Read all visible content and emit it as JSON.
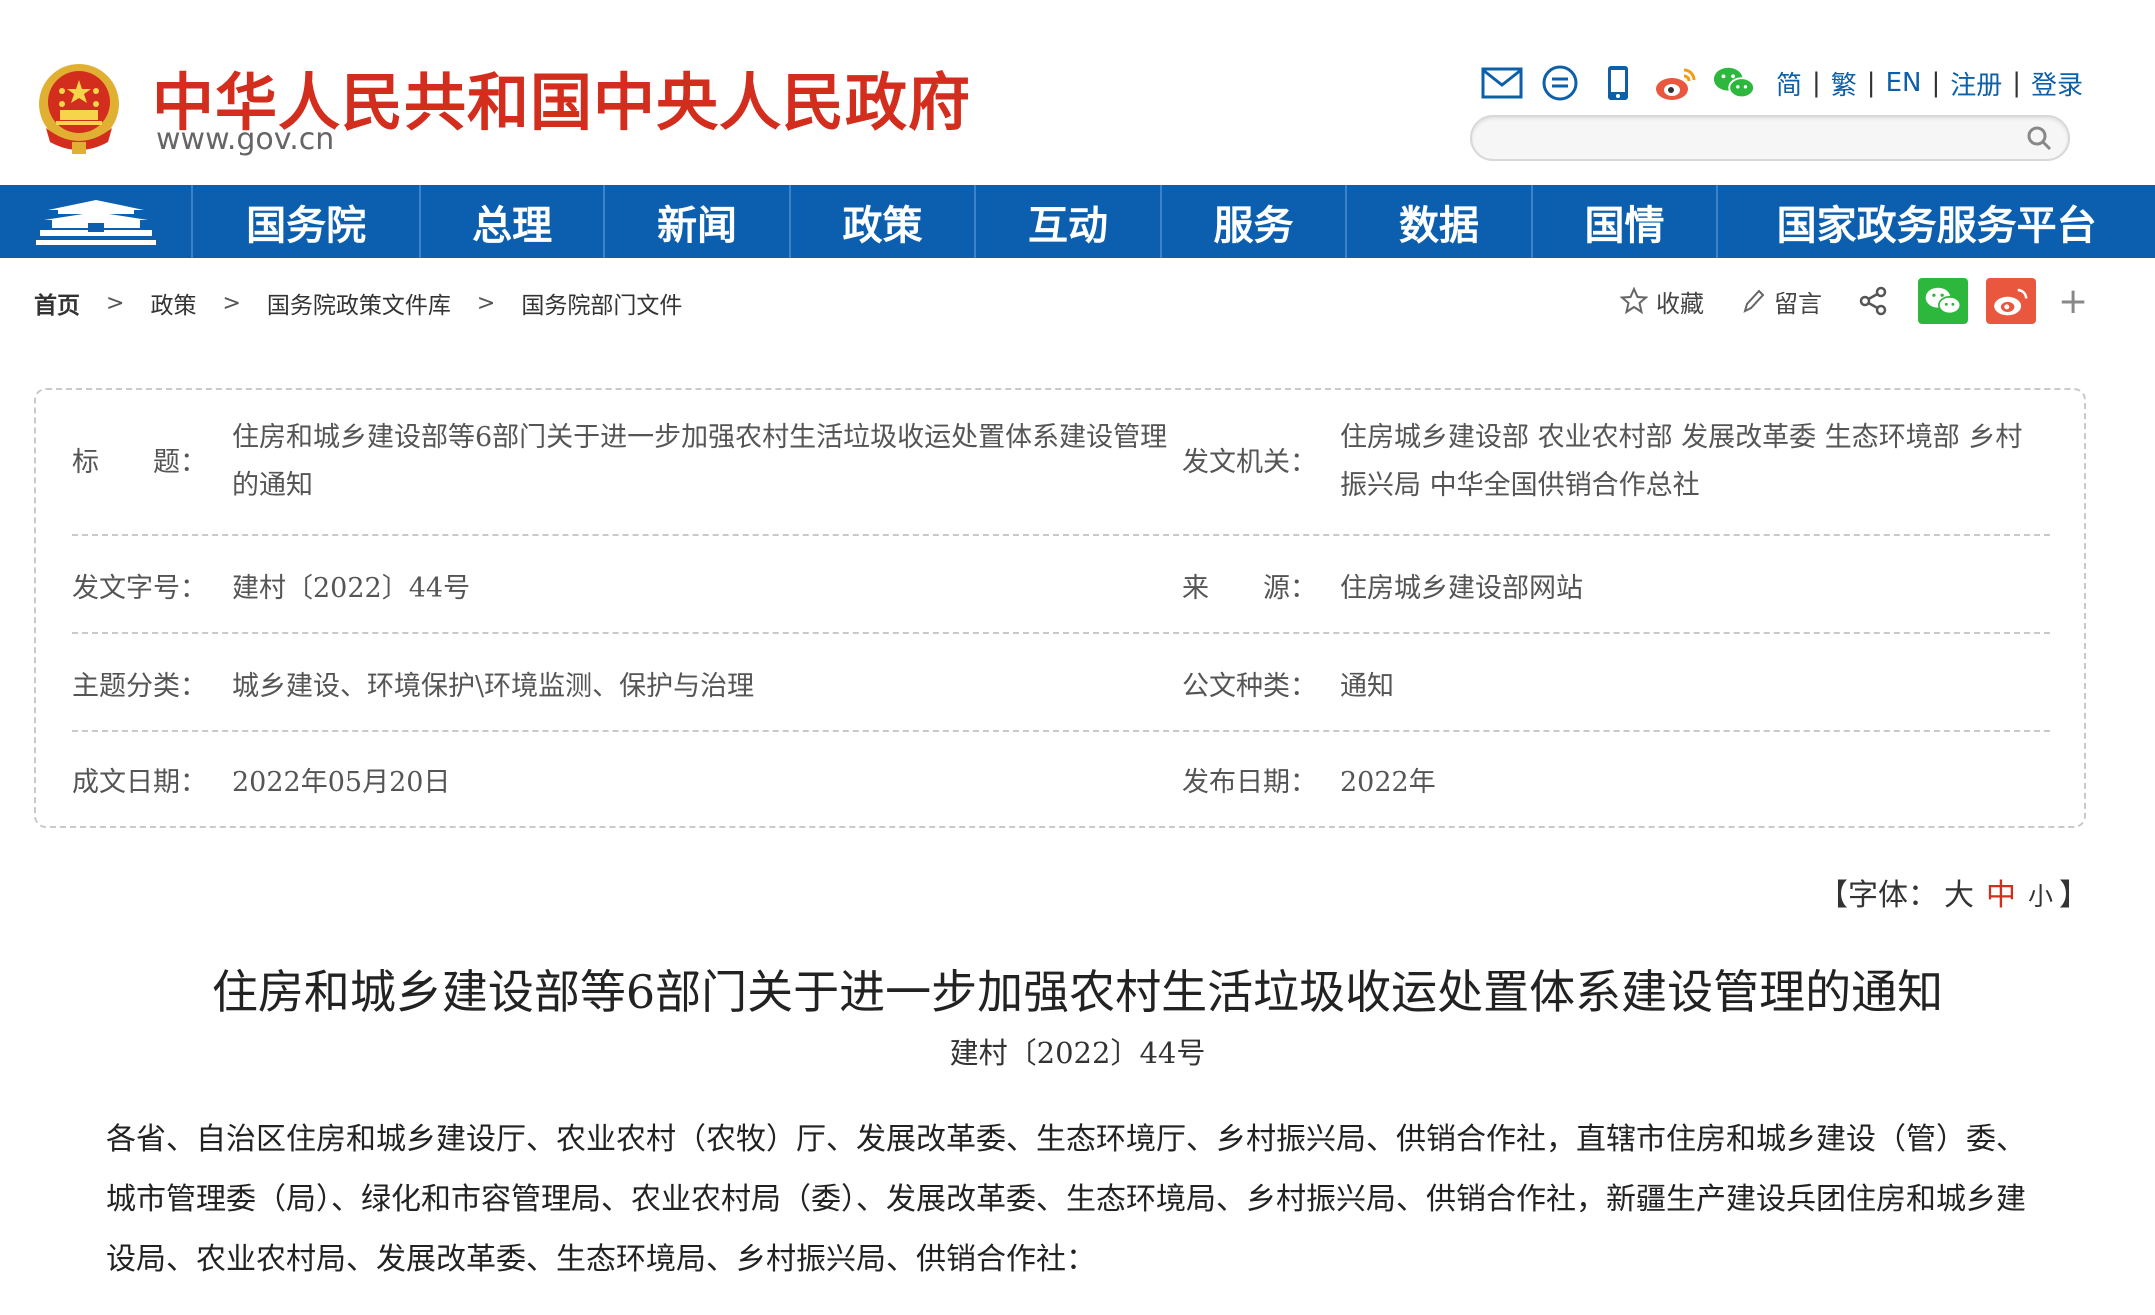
{
  "header": {
    "site_title": "中华人民共和国中央人民政府",
    "site_url": "www.gov.cn",
    "lang_links": [
      "简",
      "繁",
      "EN",
      "注册",
      "登录"
    ],
    "tool_icons": [
      "mail-icon",
      "message-icon",
      "mobile-icon",
      "weibo-icon",
      "wechat-icon"
    ],
    "search": {
      "placeholder": ""
    }
  },
  "nav": {
    "logo_icon": "tiananmen-icon",
    "items": [
      "国务院",
      "总理",
      "新闻",
      "政策",
      "互动",
      "服务",
      "数据",
      "国情",
      "国家政务服务平台"
    ]
  },
  "breadcrumb": [
    "首页",
    "政策",
    "国务院政策文件库",
    "国务院部门文件"
  ],
  "share": {
    "favorite": "收藏",
    "comment": "留言"
  },
  "meta": {
    "title_label": "标　　题：",
    "title_value": "住房和城乡建设部等6部门关于进一步加强农村生活垃圾收运处置体系建设管理的通知",
    "issuer_label": "发文机关：",
    "issuer_value": "住房城乡建设部 农业农村部 发展改革委 生态环境部 乡村振兴局 中华全国供销合作总社",
    "docnum_label": "发文字号：",
    "docnum_value": "建村〔2022〕44号",
    "source_label": "来　　源：",
    "source_value": "住房城乡建设部网站",
    "topic_label": "主题分类：",
    "topic_value": "城乡建设、环境保护\\环境监测、保护与治理",
    "type_label": "公文种类：",
    "type_value": "通知",
    "written_label": "成文日期：",
    "written_value": "2022年05月20日",
    "publish_label": "发布日期：",
    "publish_value": "2022年"
  },
  "font_size": {
    "prefix": "【字体：",
    "large": "大",
    "medium": "中",
    "small": "小",
    "suffix": "】"
  },
  "article": {
    "title": "住房和城乡建设部等6部门关于进一步加强农村生活垃圾收运处置体系建设管理的通知",
    "doc_number": "建村〔2022〕44号",
    "body": "各省、自治区住房和城乡建设厅、农业农村（农牧）厅、发展改革委、生态环境厅、乡村振兴局、供销合作社，直辖市住房和城乡建设（管）委、城市管理委（局）、绿化和市容管理局、农业农村局（委）、发展改革委、生态环境局、乡村振兴局、供销合作社，新疆生产建设兵团住房和城乡建设局、农业农村局、发展改革委、生态环境局、乡村振兴局、供销合作社："
  },
  "colors": {
    "brand_red": "#d22d1d",
    "nav_blue": "#0b5fae",
    "link_blue": "#0d5fa8",
    "wechat_green": "#2db83d",
    "weibo_red": "#e9573f"
  }
}
